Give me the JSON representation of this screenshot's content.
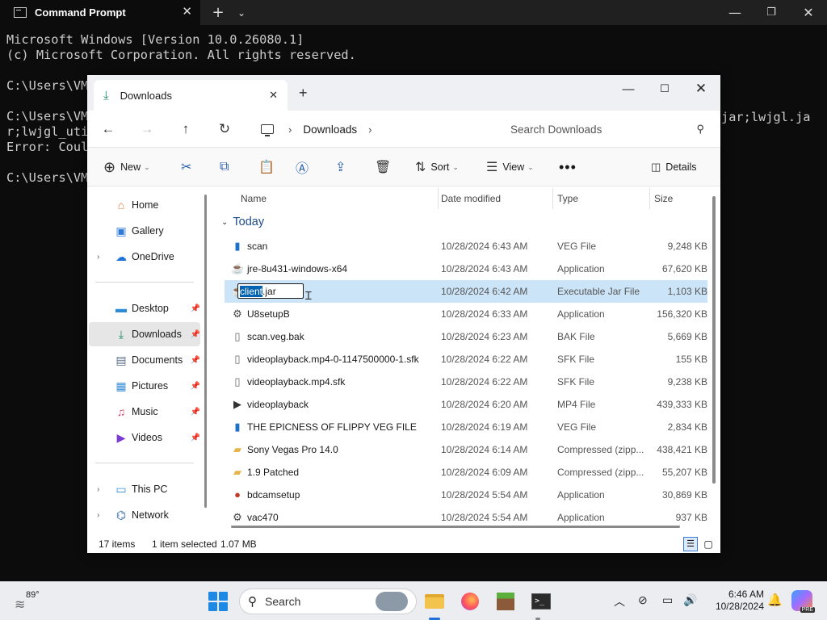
{
  "cmd": {
    "title": "Command Prompt",
    "lines": [
      "Microsoft Windows [Version 10.0.26080.1]",
      "(c) Microsoft Corporation. All rights reserved.",
      "",
      "C:\\Users\\VM",
      "",
      "C:\\Users\\VM",
      "r;lwjgl_uti",
      "Error: Coul",
      "",
      "C:\\Users\\VM"
    ],
    "overflow_lines": [
      "jar;lwjgl.ja"
    ]
  },
  "explorer": {
    "tab_title": "Downloads",
    "breadcrumb": "Downloads",
    "search_placeholder": "Search Downloads",
    "commands": {
      "new": "New",
      "sort": "Sort",
      "view": "View",
      "details": "Details"
    },
    "sidebar": [
      {
        "label": "Home",
        "icon": "home-icon",
        "chev": false,
        "pin": false
      },
      {
        "label": "Gallery",
        "icon": "gallery-icon",
        "chev": false,
        "pin": false
      },
      {
        "label": "OneDrive",
        "icon": "cloud-icon",
        "chev": true,
        "pin": false
      },
      {
        "label": "Desktop",
        "icon": "desktop-icon",
        "chev": false,
        "pin": true
      },
      {
        "label": "Downloads",
        "icon": "download-icon",
        "chev": false,
        "pin": true,
        "selected": true
      },
      {
        "label": "Documents",
        "icon": "documents-icon",
        "chev": false,
        "pin": true
      },
      {
        "label": "Pictures",
        "icon": "pictures-icon",
        "chev": false,
        "pin": true
      },
      {
        "label": "Music",
        "icon": "music-icon",
        "chev": false,
        "pin": true
      },
      {
        "label": "Videos",
        "icon": "videos-icon",
        "chev": false,
        "pin": true
      },
      {
        "label": "This PC",
        "icon": "pc-icon",
        "chev": true,
        "pin": false
      },
      {
        "label": "Network",
        "icon": "network-icon",
        "chev": true,
        "pin": false
      }
    ],
    "columns": {
      "name": "Name",
      "date": "Date modified",
      "type": "Type",
      "size": "Size"
    },
    "group": "Today",
    "files": [
      {
        "name": "scan",
        "date": "10/28/2024 6:43 AM",
        "type": "VEG File",
        "size": "9,248 KB",
        "icon": "veg-file-icon"
      },
      {
        "name": "jre-8u431-windows-x64",
        "date": "10/28/2024 6:43 AM",
        "type": "Application",
        "size": "67,620 KB",
        "icon": "java-installer-icon"
      },
      {
        "name": "client.jar",
        "date": "10/28/2024 6:42 AM",
        "type": "Executable Jar File",
        "size": "1,103 KB",
        "icon": "jar-file-icon",
        "selected": true,
        "rename_selected": "client",
        "rename_rest": ".jar"
      },
      {
        "name": "U8setupB",
        "date": "10/28/2024 6:33 AM",
        "type": "Application",
        "size": "156,320 KB",
        "icon": "setup-icon"
      },
      {
        "name": "scan.veg.bak",
        "date": "10/28/2024 6:23 AM",
        "type": "BAK File",
        "size": "5,669 KB",
        "icon": "file-icon"
      },
      {
        "name": "videoplayback.mp4-0-1147500000-1.sfk",
        "date": "10/28/2024 6:22 AM",
        "type": "SFK File",
        "size": "155 KB",
        "icon": "file-icon"
      },
      {
        "name": "videoplayback.mp4.sfk",
        "date": "10/28/2024 6:22 AM",
        "type": "SFK File",
        "size": "9,238 KB",
        "icon": "file-icon"
      },
      {
        "name": "videoplayback",
        "date": "10/28/2024 6:20 AM",
        "type": "MP4 File",
        "size": "439,333 KB",
        "icon": "video-file-icon"
      },
      {
        "name": "THE EPICNESS OF FLIPPY VEG FILE",
        "date": "10/28/2024 6:19 AM",
        "type": "VEG File",
        "size": "2,834 KB",
        "icon": "veg-file-icon"
      },
      {
        "name": "Sony Vegas Pro 14.0",
        "date": "10/28/2024 6:14 AM",
        "type": "Compressed (zipp...",
        "size": "438,421 KB",
        "icon": "zip-folder-icon"
      },
      {
        "name": "1.9 Patched",
        "date": "10/28/2024 6:09 AM",
        "type": "Compressed (zipp...",
        "size": "55,207 KB",
        "icon": "zip-folder-icon"
      },
      {
        "name": "bdcamsetup",
        "date": "10/28/2024 5:54 AM",
        "type": "Application",
        "size": "30,869 KB",
        "icon": "bandicam-icon"
      },
      {
        "name": "vac470",
        "date": "10/28/2024 5:54 AM",
        "type": "Application",
        "size": "937 KB",
        "icon": "setup-icon"
      }
    ],
    "status": {
      "count": "17 items",
      "selected": "1 item selected",
      "size": "1.07 MB"
    }
  },
  "taskbar": {
    "temperature": "89°",
    "search_label": "Search",
    "time": "6:46 AM",
    "date": "10/28/2024",
    "copilot_badge": "PRE"
  }
}
